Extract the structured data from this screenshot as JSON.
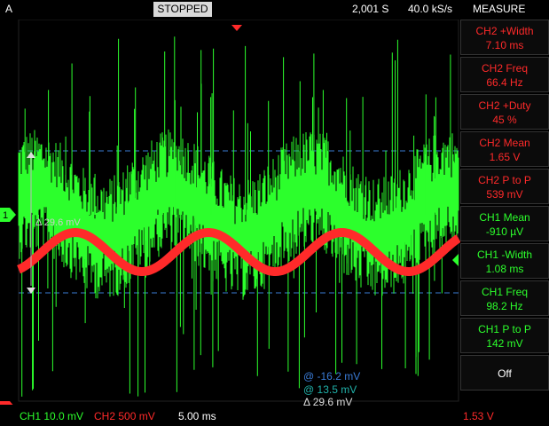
{
  "topbar": {
    "channel_letter": "A",
    "status": "STOPPED",
    "points": "2,001 S",
    "sample_rate": "40.0 kS/s",
    "mode": "MEASURE"
  },
  "measurements": [
    {
      "title": "CH2 +Width",
      "value": "7.10 ms",
      "color": "#ff2a2a"
    },
    {
      "title": "CH2 Freq",
      "value": "66.4 Hz",
      "color": "#ff2a2a"
    },
    {
      "title": "CH2 +Duty",
      "value": "45 %",
      "color": "#ff2a2a"
    },
    {
      "title": "CH2 Mean",
      "value": "1.65 V",
      "color": "#ff2a2a"
    },
    {
      "title": "CH2 P to P",
      "value": "539 mV",
      "color": "#ff2a2a"
    },
    {
      "title": "CH1 Mean",
      "value": "-910 µV",
      "color": "#2cff2c"
    },
    {
      "title": "CH1 -Width",
      "value": "1.08 ms",
      "color": "#2cff2c"
    },
    {
      "title": "CH1 Freq",
      "value": "98.2 Hz",
      "color": "#2cff2c"
    },
    {
      "title": "CH1 P to P",
      "value": "142 mV",
      "color": "#2cff2c"
    },
    {
      "title": "Off",
      "value": "",
      "color": "#ffffff"
    }
  ],
  "markers": {
    "ch1": "1",
    "ch2": "2"
  },
  "cursor": {
    "delta_left": "Δ 29.6 mV",
    "at1": "@ -16.2 mV",
    "at2": "@ 13.5 mV",
    "delta_bottom": "Δ 29.6 mV"
  },
  "bottombar": {
    "ch1_scale": "CH1 10.0 mV",
    "ch2_scale": "CH2 500 mV",
    "timebase": "5.00 ms",
    "trigger_level": "1.53 V"
  },
  "colors": {
    "ch1": "#2cff2c",
    "ch2": "#ff2a2a",
    "cursor_blue": "#3a7bd5",
    "cursor_teal": "#20b2aa"
  }
}
